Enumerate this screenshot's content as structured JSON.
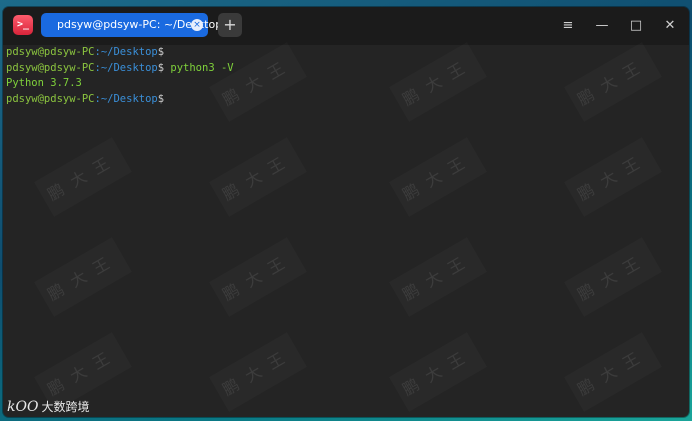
{
  "window": {
    "tab_title": "pdsyw@pdsyw-PC: ~/Desktop",
    "tab_close_icon": "×",
    "new_tab_icon": "+",
    "menu_icon": "≡",
    "minimize_icon": "—",
    "maximize_icon": "□",
    "close_icon": "✕"
  },
  "terminal": {
    "lines": [
      {
        "user": "pdsyw@pdsyw-PC",
        "path": ":~/Desktop",
        "prompt": "$",
        "command": ""
      },
      {
        "user": "pdsyw@pdsyw-PC",
        "path": ":~/Desktop",
        "prompt": "$",
        "command": " python3 -V"
      },
      {
        "output": "Python 3.7.3"
      },
      {
        "user": "pdsyw@pdsyw-PC",
        "path": ":~/Desktop",
        "prompt": "$",
        "command": ""
      }
    ]
  },
  "watermark": {
    "text": "鹏大王"
  },
  "branding": {
    "mark": "kOO",
    "text": "大数跨境"
  },
  "colors": {
    "user": "#8bc43f",
    "path": "#3a8fd8",
    "tab_active": "#1a6ae0",
    "terminal_bg": "#242424"
  }
}
